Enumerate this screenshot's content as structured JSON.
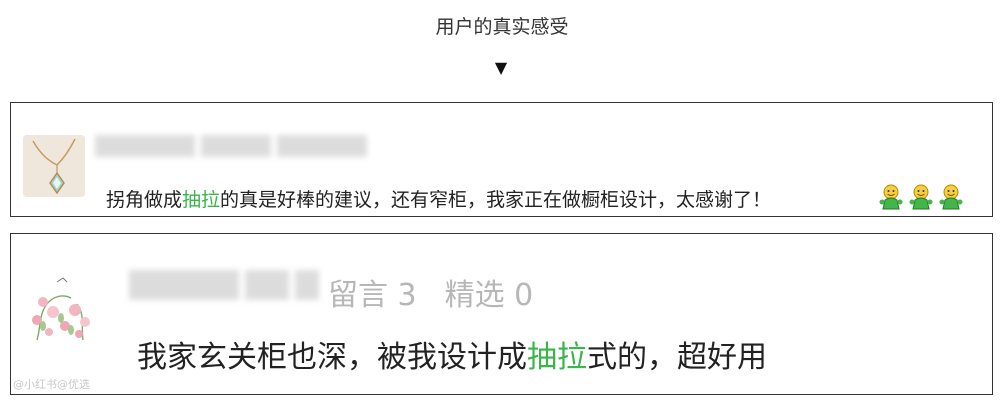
{
  "header": {
    "title": "用户的真实感受",
    "arrow": "▼"
  },
  "cards": [
    {
      "comment": {
        "part1": "拐角做成",
        "highlight": "抽拉",
        "part2": "的真是好棒的建议，还有窄柜，我家正在做橱柜设计，太感谢了！"
      },
      "emoji_icon": "smiley-figure-icon",
      "emoji_count": 3
    },
    {
      "meta": {
        "comments_label": "留言 3",
        "selected_label": "精选 0"
      },
      "comment": {
        "part1": "我家玄关柜也深，被我设计成",
        "highlight": "抽拉",
        "part2": "式的，超好用"
      },
      "watermark": "@小红书@优选"
    }
  ],
  "colors": {
    "highlight": "#39b54a",
    "meta": "#b7b7b7",
    "border": "#333333"
  }
}
